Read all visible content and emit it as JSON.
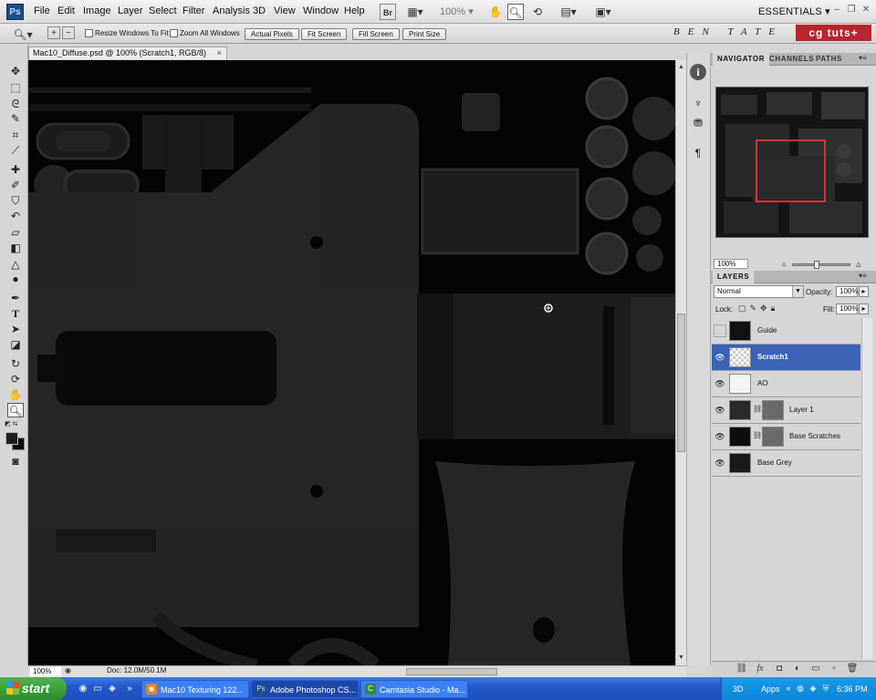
{
  "app": {
    "logo": "Ps",
    "menu": [
      "File",
      "Edit",
      "Image",
      "Layer",
      "Select",
      "Filter",
      "Analysis",
      "3D",
      "View",
      "Window",
      "Help"
    ],
    "zoom_combo": "100%",
    "workspace": "ESSENTIALS"
  },
  "options_bar": {
    "resize_windows_label": "Resize Windows To Fit",
    "resize_windows_checked": false,
    "zoom_all_label": "Zoom All Windows",
    "zoom_all_checked": false,
    "buttons": [
      "Actual Pixels",
      "Fit Screen",
      "Fill Screen",
      "Print Size"
    ],
    "brand_text": "BEN TATE",
    "brand_logo": "cg tuts+"
  },
  "document": {
    "tab_title": "Mac10_Diffuse.psd @ 100% (Scratch1, RGB/8)",
    "tab_close": "×",
    "zoom": "100%",
    "doc_size": "Doc: 12.0M/50.1M"
  },
  "toolbox": {
    "tools": [
      "move-tool",
      "marquee-tool",
      "lasso-tool",
      "quick-selection-tool",
      "crop-tool",
      "eyedropper-tool",
      "healing-brush-tool",
      "brush-tool",
      "clone-stamp-tool",
      "history-brush-tool",
      "eraser-tool",
      "gradient-tool",
      "blur-tool",
      "dodge-tool",
      "pen-tool",
      "type-tool",
      "path-selection-tool",
      "shape-tool",
      "3d-rotate-tool",
      "3d-orbit-tool",
      "hand-tool",
      "zoom-tool"
    ],
    "selected_tool": "zoom-tool",
    "foreground_color": "#1e1e1e",
    "background_color": "#000000"
  },
  "navigator": {
    "tabs": [
      "NAVIGATOR",
      "CHANNELS",
      "PATHS"
    ],
    "active_tab": "NAVIGATOR",
    "zoom": "100%"
  },
  "layers_panel": {
    "title": "LAYERS",
    "blend_mode": "Normal",
    "opacity_label": "Opacity:",
    "opacity": "100%",
    "lock_label": "Lock:",
    "fill_label": "Fill:",
    "fill": "100%",
    "layers": [
      {
        "name": "Guide",
        "visible": false,
        "selected": false,
        "has_mask": false,
        "thumb": "#111111"
      },
      {
        "name": "Scratch1",
        "visible": true,
        "selected": true,
        "has_mask": false,
        "thumb": "#dddddd"
      },
      {
        "name": "AO",
        "visible": true,
        "selected": false,
        "has_mask": false,
        "thumb": "#f4f4f4"
      },
      {
        "name": "Layer 1",
        "visible": true,
        "selected": false,
        "has_mask": true,
        "thumb": "#2a2a2a"
      },
      {
        "name": "Base Scratches",
        "visible": true,
        "selected": false,
        "has_mask": true,
        "thumb": "#0e0e0e"
      },
      {
        "name": "Base Grey",
        "visible": true,
        "selected": false,
        "has_mask": false,
        "thumb": "#1a1a1a"
      }
    ]
  },
  "taskbar": {
    "start_label": "start",
    "tasks": [
      {
        "label": "Mac10 Texturing 122...",
        "active": false
      },
      {
        "label": "Adobe Photoshop CS...",
        "active": true
      },
      {
        "label": "Camtasia Studio - Ma...",
        "active": false
      }
    ],
    "tray_labels": [
      "3D",
      "Apps"
    ],
    "clock": "6:36 PM"
  }
}
